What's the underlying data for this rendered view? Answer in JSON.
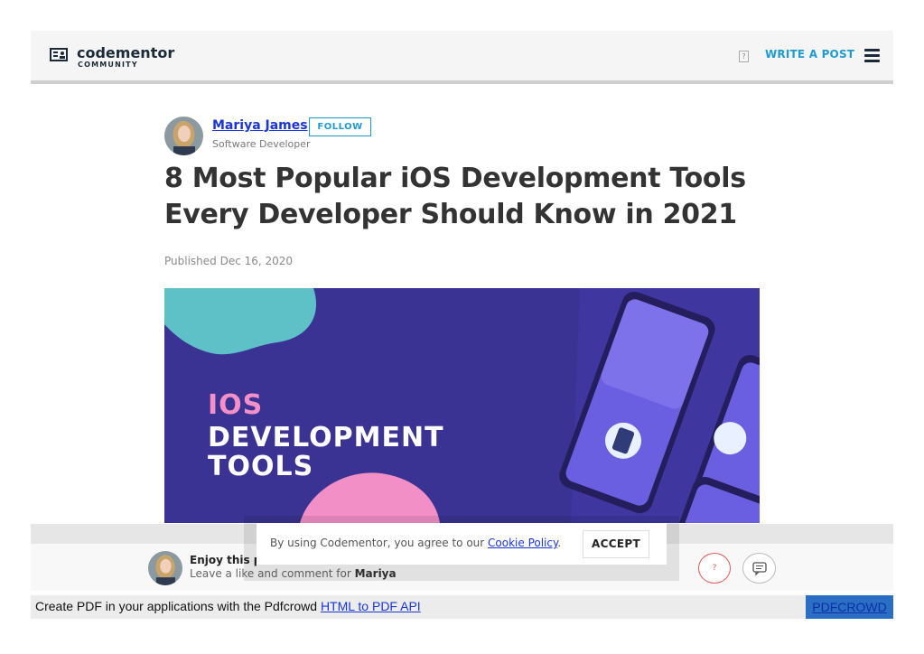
{
  "header": {
    "logo_name": "codementor",
    "logo_sub": "COMMUNITY",
    "write_post_label": "WRITE A POST"
  },
  "author": {
    "name": "Mariya James",
    "follow_label": "FOLLOW",
    "role": "Software Developer"
  },
  "article": {
    "title": "8 Most Popular iOS Development Tools Every Developer Should Know in 2021",
    "published": "Published Dec 16, 2020",
    "hero_lines": [
      "IOS",
      "DEVELOPMENT",
      "TOOLS"
    ]
  },
  "engage": {
    "title": "Enjoy this p",
    "sub_prefix": "Leave a like and comment for ",
    "sub_name": "Mariya"
  },
  "cookie": {
    "text_prefix": "By using Codementor, you agree to our ",
    "link": "Cookie Policy",
    "text_suffix": ".",
    "accept_label": "ACCEPT"
  },
  "footer": {
    "text": "Create PDF in your applications with the Pdfcrowd ",
    "link": "HTML to PDF API",
    "brand": "PDFCROWD"
  },
  "colors": {
    "accent": "#1f9bd0",
    "link": "#1a35d8",
    "hero_bg": "#3b3393",
    "hero_pink": "#f48fc8",
    "like_red": "#e05757"
  }
}
